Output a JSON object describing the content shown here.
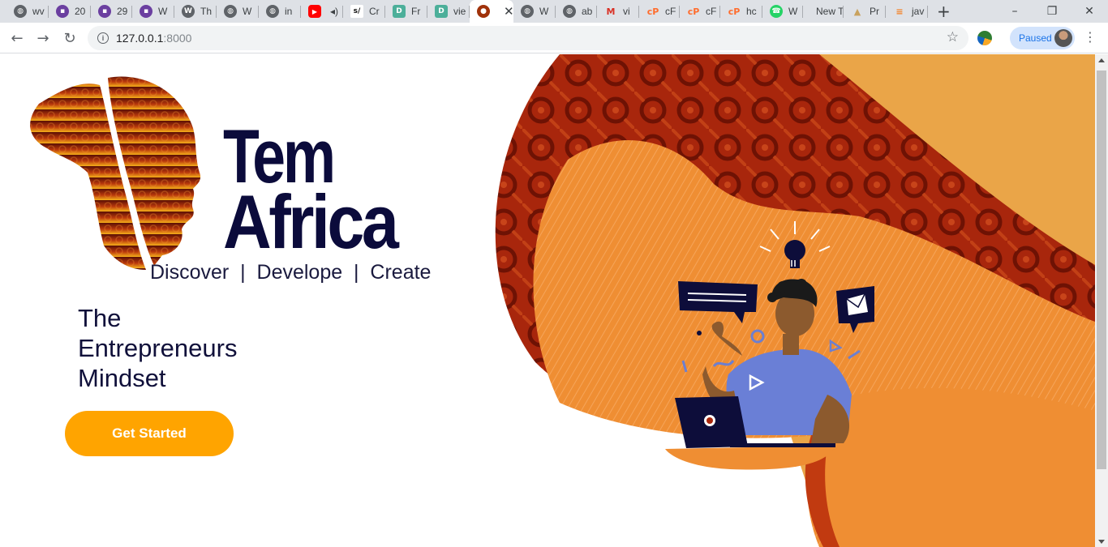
{
  "browser": {
    "tabs": [
      {
        "title": "wv",
        "icon": "globe-icon",
        "color": "#5f6368"
      },
      {
        "title": "20",
        "icon": "colorlib-icon",
        "color": "#6b3fa0"
      },
      {
        "title": "29",
        "icon": "colorlib-icon",
        "color": "#6b3fa0"
      },
      {
        "title": "W",
        "icon": "colorlib-icon",
        "color": "#6b3fa0"
      },
      {
        "title": "Th",
        "icon": "wordpress-icon",
        "color": "#5f6368"
      },
      {
        "title": "W",
        "icon": "globe-icon",
        "color": "#5f6368"
      },
      {
        "title": "in",
        "icon": "globe-icon",
        "color": "#5f6368"
      },
      {
        "title": "",
        "icon": "youtube-icon",
        "color": "#ff0000"
      },
      {
        "title": "Cr",
        "icon": "sj-icon",
        "color": "#111111"
      },
      {
        "title": "Fr",
        "icon": "d-icon",
        "color": "#4caf9a"
      },
      {
        "title": "vie",
        "icon": "d-icon",
        "color": "#4caf9a"
      },
      {
        "title": "",
        "icon": "temafrica-icon",
        "color": "#a0320a",
        "active": true
      },
      {
        "title": "W",
        "icon": "globe-icon",
        "color": "#5f6368"
      },
      {
        "title": "ab",
        "icon": "globe-icon",
        "color": "#5f6368"
      },
      {
        "title": "vi",
        "icon": "gmail-icon",
        "color": "#d93025"
      },
      {
        "title": "cF",
        "icon": "cpanel-icon",
        "color": "#ff6c2c"
      },
      {
        "title": "cF",
        "icon": "cpanel-icon",
        "color": "#ff6c2c"
      },
      {
        "title": "hc",
        "icon": "cpanel-icon",
        "color": "#ff6c2c"
      },
      {
        "title": "W",
        "icon": "whatsapp-icon",
        "color": "#25d366"
      },
      {
        "title": "New T",
        "icon": "",
        "color": ""
      },
      {
        "title": "Pr",
        "icon": "pr-icon",
        "color": "#c9a25e"
      },
      {
        "title": "jav",
        "icon": "stackoverflow-icon",
        "color": "#f48024"
      }
    ],
    "new_tab": "+",
    "window": {
      "minimize": "–",
      "restore": "❐",
      "close": "✕"
    },
    "nav": {
      "back": "←",
      "forward": "→",
      "reload": "↻"
    },
    "address": {
      "host": "127.0.0.1",
      "port": ":8000",
      "info": "i"
    },
    "bookmark_star": "☆",
    "profile_label": "Paused",
    "menu": "⋮"
  },
  "page": {
    "brand_line1": "Tem",
    "brand_line2": "Africa",
    "tagline": "Discover  |  Develope  |  Create",
    "headline": [
      "The",
      "Entrepreneurs",
      "Mindset"
    ],
    "cta_label": "Get Started"
  },
  "colors": {
    "brand_navy": "#0b0b3b",
    "cta_orange": "#ffa400",
    "art_orange": "#ef8e33",
    "art_sand": "#eaa548",
    "art_red": "#a8260c"
  }
}
